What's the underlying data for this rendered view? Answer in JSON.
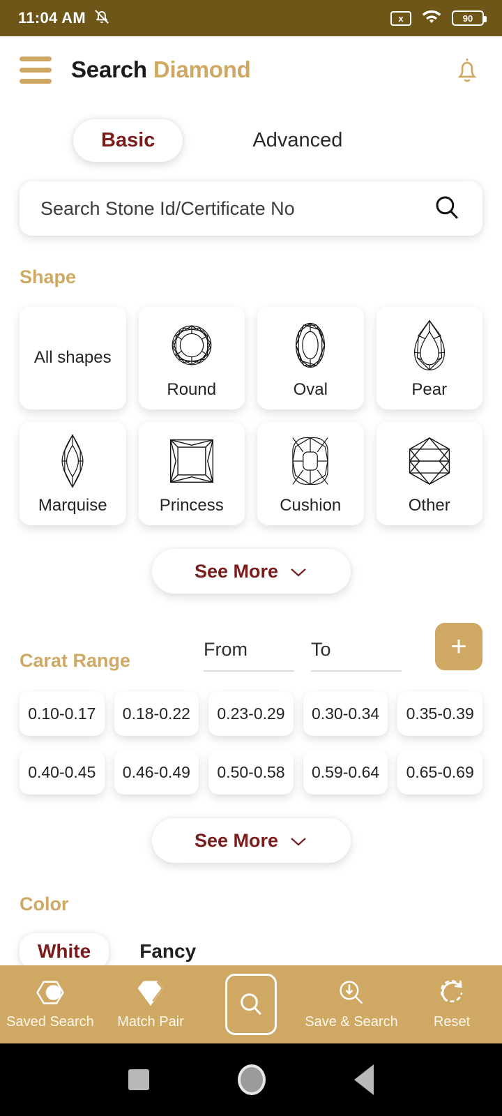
{
  "statusbar": {
    "time": "11:04 AM",
    "mute_icon": "bell-mute-icon",
    "sim_icon_label": "x",
    "wifi_icon": "wifi-icon",
    "battery_level": "90"
  },
  "appbar": {
    "menu_icon": "hamburger-menu-icon",
    "title_primary": "Search",
    "title_accent": "Diamond",
    "notification_icon": "bell-icon"
  },
  "tabs": [
    {
      "label": "Basic",
      "active": true
    },
    {
      "label": "Advanced",
      "active": false
    }
  ],
  "search": {
    "placeholder": "Search Stone Id/Certificate No",
    "value": "",
    "icon": "search-icon"
  },
  "shape": {
    "title": "Shape",
    "items": [
      {
        "label": "All shapes",
        "icon": ""
      },
      {
        "label": "Round",
        "icon": "round-diamond-icon"
      },
      {
        "label": "Oval",
        "icon": "oval-diamond-icon"
      },
      {
        "label": "Pear",
        "icon": "pear-diamond-icon"
      },
      {
        "label": "Marquise",
        "icon": "marquise-diamond-icon"
      },
      {
        "label": "Princess",
        "icon": "princess-diamond-icon"
      },
      {
        "label": "Cushion",
        "icon": "cushion-diamond-icon"
      },
      {
        "label": "Other",
        "icon": "other-diamond-icon"
      }
    ],
    "see_more": "See More"
  },
  "carat": {
    "title": "Carat Range",
    "from_placeholder": "From",
    "from_value": "",
    "to_placeholder": "To",
    "to_value": "",
    "add_label": "+",
    "ranges": [
      "0.10-0.17",
      "0.18-0.22",
      "0.23-0.29",
      "0.30-0.34",
      "0.35-0.39",
      "0.40-0.45",
      "0.46-0.49",
      "0.50-0.58",
      "0.59-0.64",
      "0.65-0.69"
    ],
    "see_more": "See More"
  },
  "color": {
    "title": "Color",
    "tabs": [
      {
        "label": "White",
        "active": true
      },
      {
        "label": "Fancy",
        "active": false
      }
    ]
  },
  "bottomnav": [
    {
      "label": "Saved Search",
      "icon": "saved-search-icon"
    },
    {
      "label": "Match Pair",
      "icon": "match-pair-icon"
    },
    {
      "label": "",
      "icon": "search-icon"
    },
    {
      "label": "Save & Search",
      "icon": "save-search-icon"
    },
    {
      "label": "Reset",
      "icon": "reset-icon"
    }
  ],
  "androidnav": {
    "recents": "recents-square-icon",
    "home": "home-circle-icon",
    "back": "back-triangle-icon"
  },
  "colors": {
    "gold": "#cfa963",
    "statusbar": "#6d5618",
    "maroon": "#7b1c1c"
  }
}
